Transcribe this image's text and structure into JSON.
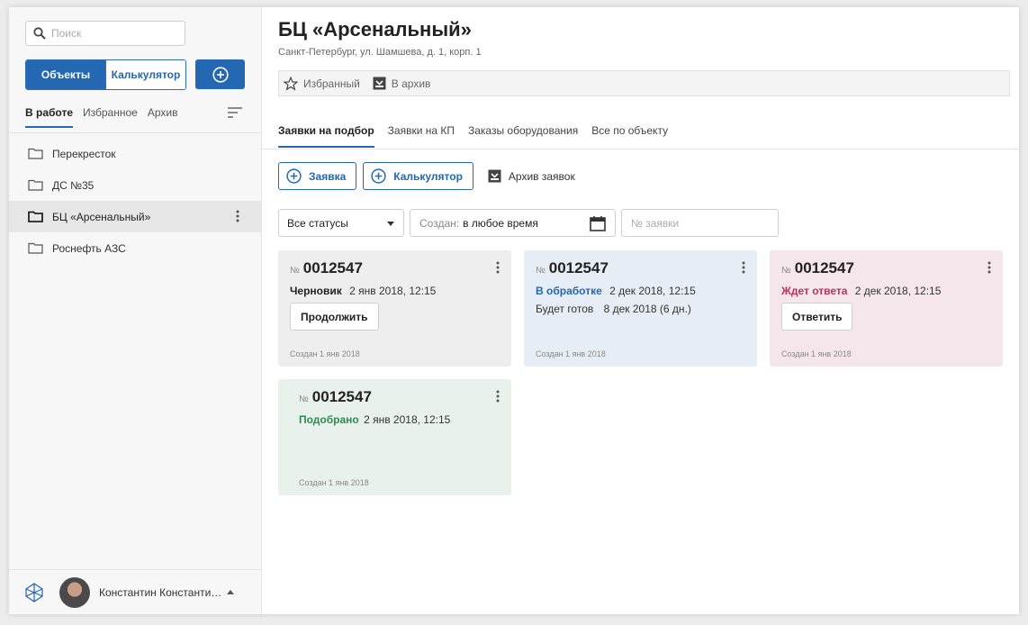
{
  "colors": {
    "accent": "#2467b2",
    "status_draft": "#222222",
    "status_processing": "#2467b2",
    "status_waiting": "#c0305a",
    "status_matched": "#2e8b4f"
  },
  "sidebar": {
    "search_placeholder": "Поиск",
    "seg_objects": "Объекты",
    "seg_calculator": "Калькулятор",
    "tabs": [
      "В работе",
      "Избранное",
      "Архив"
    ],
    "folders": [
      "Перекресток",
      "ДС №35",
      "БЦ «Арсенальный»",
      "Роснефть АЗС"
    ],
    "user_name": "Константин Константи…"
  },
  "main": {
    "title": "БЦ «Арсенальный»",
    "address": "Санкт-Петербург, ул. Шамшева, д. 1, корп. 1",
    "favorite_label": "Избранный",
    "archive_label": "В архив",
    "tabs": [
      "Заявки на подбор",
      "Заявки на КП",
      "Заказы оборудования",
      "Все по объекту"
    ],
    "btn_request": "Заявка",
    "btn_calculator": "Калькулятор",
    "btn_archive": "Архив заявок",
    "status_select": "Все статусы",
    "created_label": "Создан:",
    "created_value": "в любое время",
    "number_placeholder": "№ заявки"
  },
  "cards": [
    {
      "nsign": "№",
      "number": "0012547",
      "status": "Черновик",
      "date": "2 янв 2018, 12:15",
      "button": "Продолжить",
      "created": "Создан 1 янв 2018"
    },
    {
      "nsign": "№",
      "number": "0012547",
      "status": "В обработке",
      "date": "2 дек 2018, 12:15",
      "ready_label": "Будет готов",
      "ready_value": "8 дек 2018 (6 дн.)",
      "created": "Создан 1 янв 2018"
    },
    {
      "nsign": "№",
      "number": "0012547",
      "status": "Ждет ответа",
      "date": "2 дек 2018, 12:15",
      "button": "Ответить",
      "created": "Создан 1 янв 2018"
    },
    {
      "nsign": "№",
      "number": "0012547",
      "status": "Подобрано",
      "date": "2 янв 2018, 12:15",
      "created": "Создан 1 янв 2018"
    }
  ]
}
